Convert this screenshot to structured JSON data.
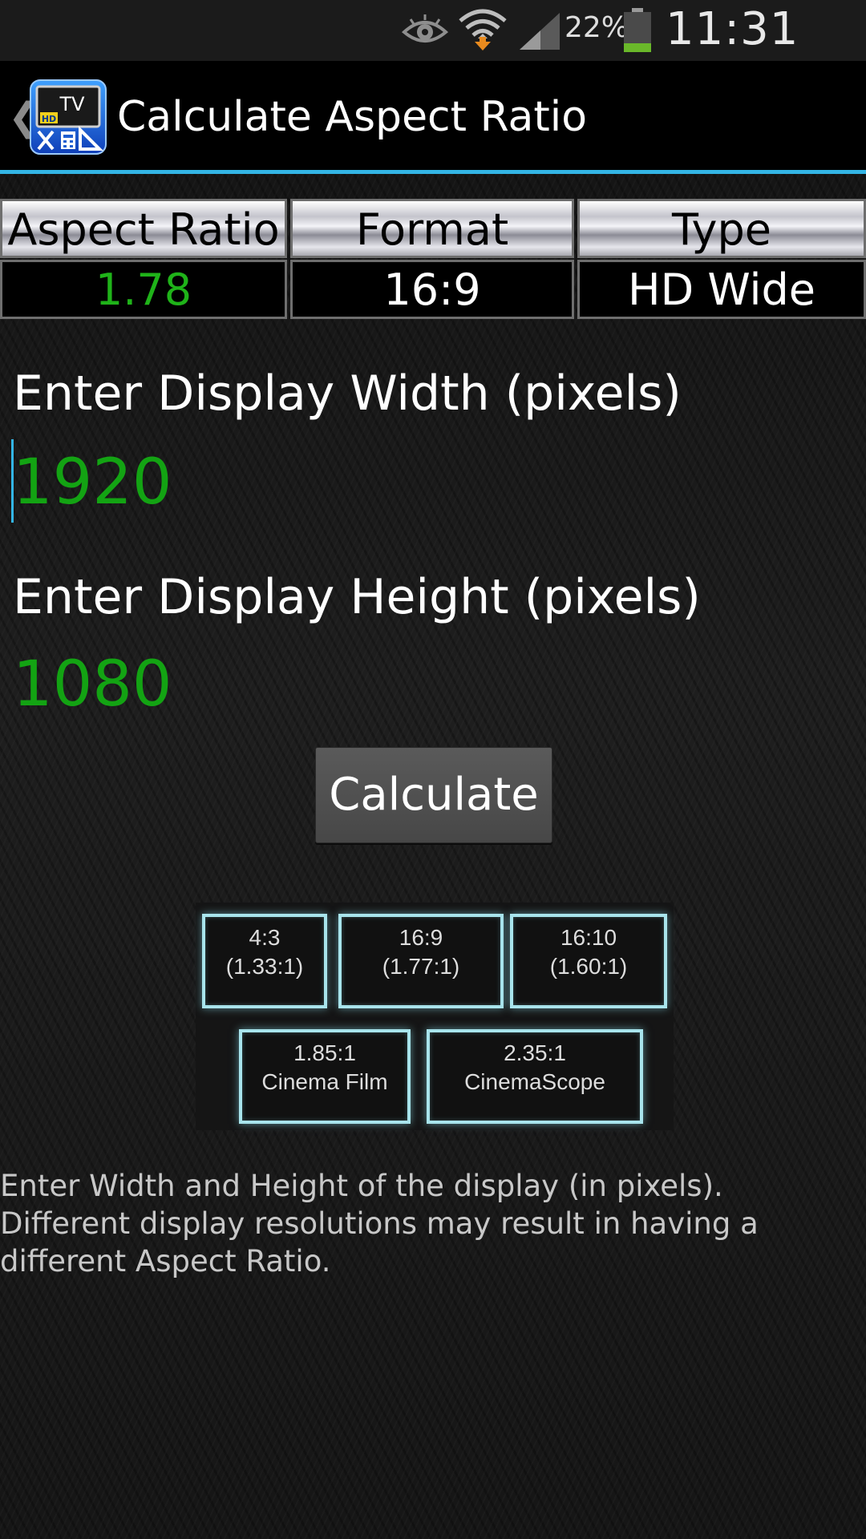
{
  "status_bar": {
    "battery_percent": "22%",
    "time": "11:31 AM",
    "icons": [
      "eye-icon",
      "wifi-icon",
      "signal-icon",
      "battery-icon"
    ]
  },
  "action_bar": {
    "title": "Calculate Aspect Ratio",
    "icon_label": "TV",
    "icon_badge": "HD"
  },
  "results": {
    "headers": {
      "aspect_ratio": "Aspect Ratio",
      "format": "Format",
      "type": "Type"
    },
    "values": {
      "aspect_ratio": "1.78",
      "format": "16:9",
      "type": "HD Wide"
    }
  },
  "width_field": {
    "label": "Enter Display Width (pixels)",
    "value": "1920"
  },
  "height_field": {
    "label": "Enter Display Height (pixels)",
    "value": "1080"
  },
  "calculate_label": "Calculate",
  "ratio_boxes": [
    {
      "line1": "4:3",
      "line2": "(1.33:1)"
    },
    {
      "line1": "16:9",
      "line2": "(1.77:1)"
    },
    {
      "line1": "16:10",
      "line2": "(1.60:1)"
    },
    {
      "line1": "1.85:1",
      "line2": "Cinema Film"
    },
    {
      "line1": "2.35:1",
      "line2": "CinemaScope"
    }
  ],
  "help_text": "Enter Width and Height of the display (in pixels). Different display resolutions may result in having a different Aspect Ratio.",
  "colors": {
    "accent": "#33b5e5",
    "value_green": "#1fb319",
    "battery_green": "#6ab82a"
  }
}
